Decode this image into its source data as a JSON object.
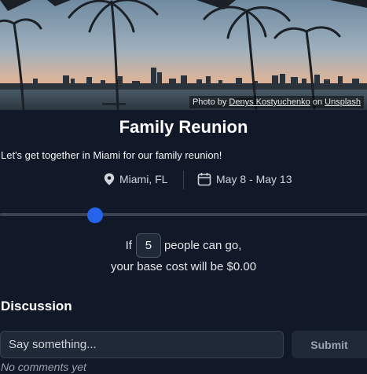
{
  "hero": {
    "credit_prefix": "Photo by",
    "credit_author": "Denys Kostyuchenko",
    "credit_mid": "on",
    "credit_source": "Unsplash"
  },
  "event": {
    "title": "Family Reunion",
    "description": "Let's get together in Miami for our family reunion!",
    "location": "Miami, FL",
    "dates": "May 8 - May 13"
  },
  "cost": {
    "people_prefix": "If",
    "people_count": "5",
    "people_suffix": "people can go,",
    "cost_text": "your base cost will be $0.00",
    "slider_fraction": 0.26
  },
  "discussion": {
    "heading": "Discussion",
    "input_placeholder": "Say something...",
    "submit_label": "Submit",
    "empty_text": "No comments yet"
  },
  "colors": {
    "background": "#111827",
    "accent": "#2563eb",
    "input_bg": "#1f2937"
  },
  "icons": {
    "location": "map-pin-icon",
    "date": "calendar-icon"
  }
}
